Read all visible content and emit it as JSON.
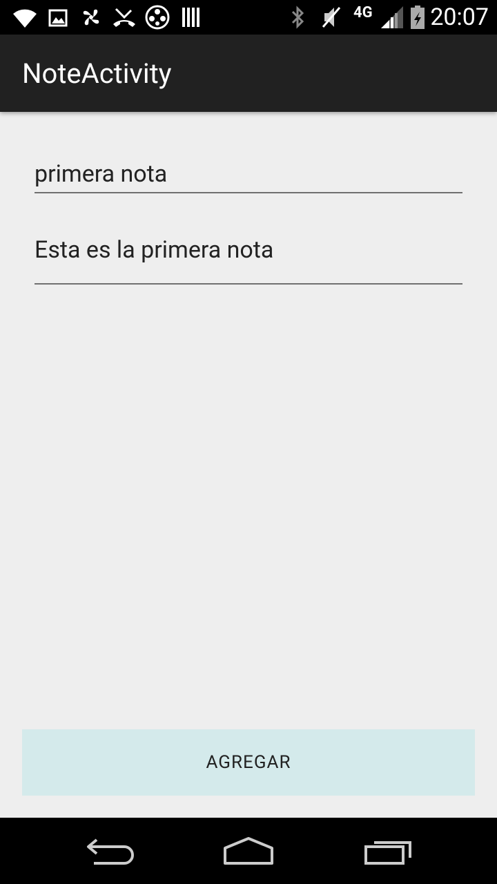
{
  "status_bar": {
    "time": "20:07",
    "network_label": "4G",
    "icons": [
      "wifi-icon",
      "image-icon",
      "pinwheel-icon",
      "missed-call-icon",
      "reel-icon",
      "barcode-icon",
      "bluetooth-icon",
      "mute-icon",
      "signal-icon",
      "battery-icon"
    ]
  },
  "action_bar": {
    "title": "NoteActivity"
  },
  "form": {
    "title_value": "primera nota",
    "body_value": "Esta es la primera nota",
    "add_button_label": "AGREGAR",
    "button_color": "#d4eaeb"
  },
  "nav_bar": {
    "icons": [
      "back-icon",
      "home-icon",
      "recents-icon"
    ]
  }
}
